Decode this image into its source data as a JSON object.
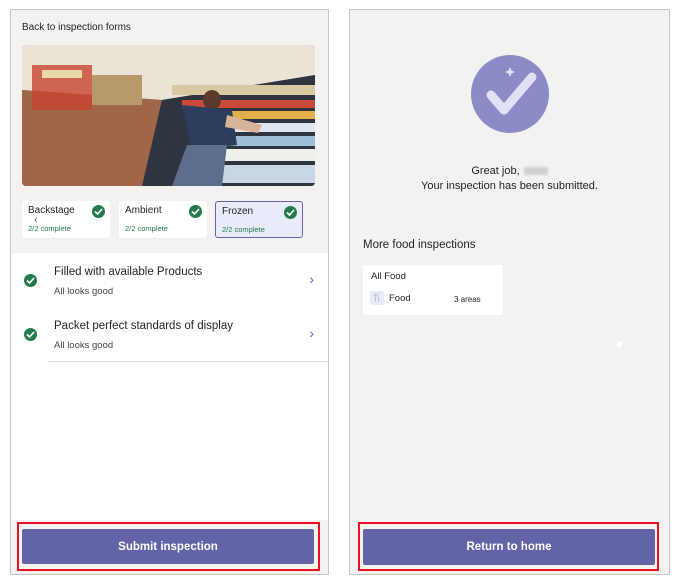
{
  "left_panel": {
    "back_label": "Back to inspection forms",
    "areas": [
      {
        "name": "Backstage",
        "status": "2/2 complete"
      },
      {
        "name": "Ambient",
        "status": "2/2 complete"
      },
      {
        "name": "Frozen",
        "status": "2/2 complete"
      }
    ],
    "items": [
      {
        "title": "Filled with available Products",
        "subtitle": "All looks good"
      },
      {
        "title": "Packet perfect standards of display",
        "subtitle": "All looks good"
      }
    ],
    "submit_label": "Submit inspection"
  },
  "right_panel": {
    "greeting": "Great job,",
    "submitted_message": "Your inspection has been submitted.",
    "more_heading": "More food inspections",
    "form_card": {
      "title": "All Food",
      "area_label": "Food",
      "area_count": "3 areas"
    },
    "return_label": "Return to home"
  },
  "colors": {
    "accent": "#6264a7",
    "success": "#237b4b",
    "highlight_frame": "#e81123",
    "panel_bg": "#f3f2f1"
  },
  "icons": [
    "chevron-left-icon",
    "check-circle-icon",
    "chevron-right-icon",
    "checkmark-badge-icon",
    "utensils-icon"
  ]
}
